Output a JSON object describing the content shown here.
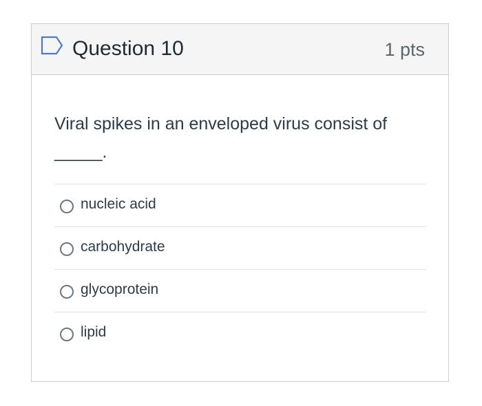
{
  "question": {
    "title": "Question 10",
    "points": "1 pts",
    "text": "Viral spikes in an enveloped virus consist of _____.",
    "answers": [
      {
        "label": "nucleic acid"
      },
      {
        "label": "carbohydrate"
      },
      {
        "label": "glycoprotein"
      },
      {
        "label": "lipid"
      }
    ]
  },
  "icons": {
    "flag": "flag-outline-icon",
    "radio": "radio-unchecked-icon"
  },
  "colors": {
    "header_bg": "#f5f5f5",
    "border": "#c7cdd1",
    "flag_stroke": "#4f7cb8",
    "text": "#2d3b45"
  }
}
